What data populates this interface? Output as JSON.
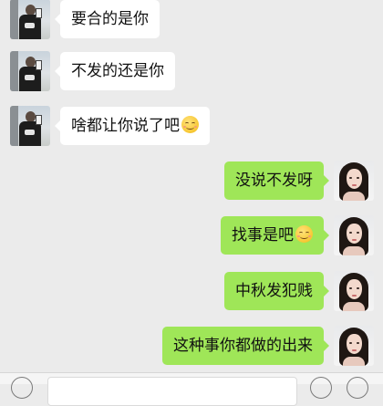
{
  "chat": {
    "messages": [
      {
        "side": "left",
        "text": "要合的是你",
        "emoji": false
      },
      {
        "side": "left",
        "text": "不发的还是你",
        "emoji": false
      },
      {
        "side": "left",
        "text": "啥都让你说了吧",
        "emoji": true
      },
      {
        "side": "right",
        "text": "没说不发呀",
        "emoji": false
      },
      {
        "side": "right",
        "text": "找事是吧",
        "emoji": true
      },
      {
        "side": "right",
        "text": "中秋发犯贱",
        "emoji": false
      },
      {
        "side": "right",
        "text": "这种事你都做的出来",
        "emoji": false
      }
    ]
  },
  "emoji_icon": "smiling-face-icon",
  "colors": {
    "background": "#ebebeb",
    "incoming_bubble": "#ffffff",
    "outgoing_bubble": "#9fe658"
  }
}
